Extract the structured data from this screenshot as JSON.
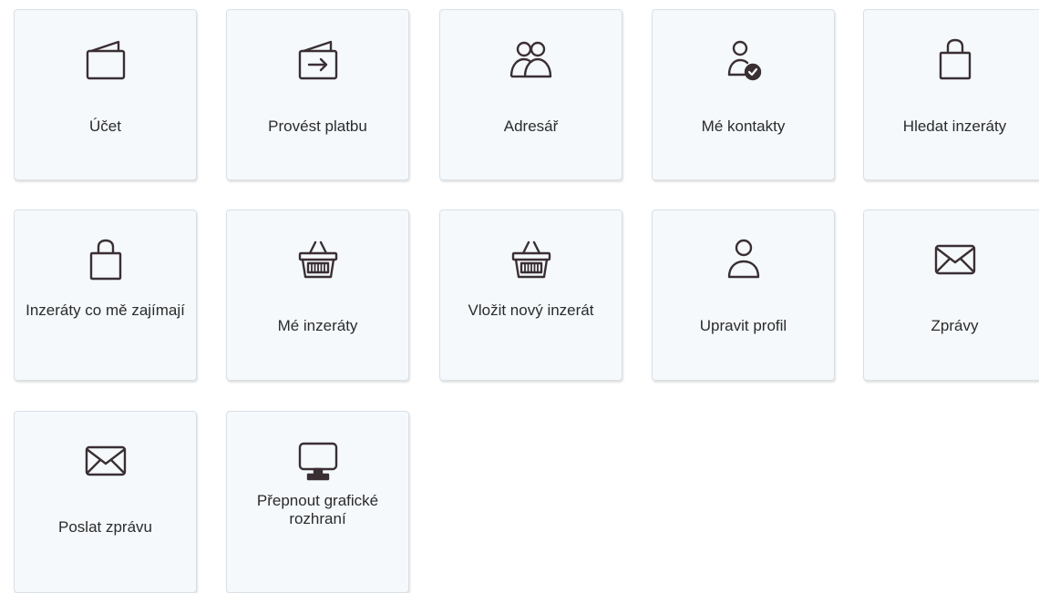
{
  "colors": {
    "tile_background": "#f5f9fc",
    "tile_border": "#d9e0e6",
    "icon_stroke": "#3a2f33",
    "label_text": "#2b2b2b"
  },
  "tiles": [
    {
      "label": "Účet",
      "icon": "wallet-icon"
    },
    {
      "label": "Provést platbu",
      "icon": "payment-icon"
    },
    {
      "label": "Adresář",
      "icon": "users-icon"
    },
    {
      "label": "Mé kontakty",
      "icon": "contact-check-icon"
    },
    {
      "label": "Hledat inzeráty",
      "icon": "shopping-bag-icon"
    },
    {
      "label": "Inzeráty co mě zajímají",
      "icon": "shopping-bag-icon"
    },
    {
      "label": "Mé inzeráty",
      "icon": "basket-icon"
    },
    {
      "label": "Vložit nový inzerát",
      "icon": "basket-icon"
    },
    {
      "label": "Upravit profil",
      "icon": "user-icon"
    },
    {
      "label": "Zprávy",
      "icon": "envelope-icon"
    },
    {
      "label": "Poslat zprávu",
      "icon": "envelope-icon"
    },
    {
      "label": "Přepnout grafické rozhraní",
      "icon": "monitor-icon"
    }
  ]
}
